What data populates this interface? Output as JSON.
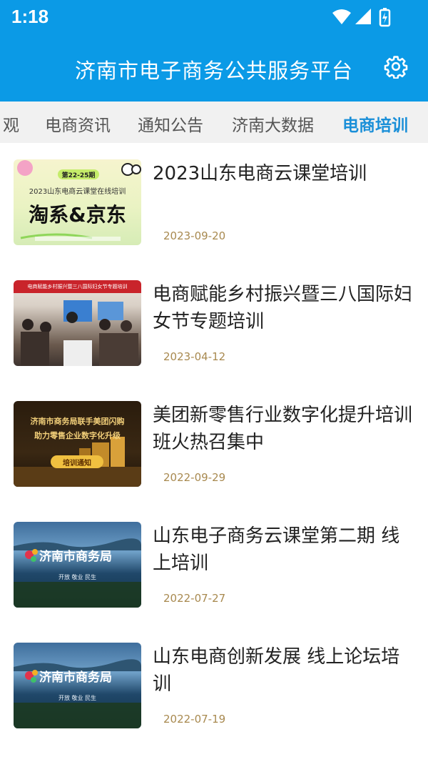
{
  "status": {
    "time": "1:18"
  },
  "app": {
    "title": "济南市电子商务公共服务平台"
  },
  "tabs": [
    {
      "label": "观"
    },
    {
      "label": "电商资讯"
    },
    {
      "label": "通知公告"
    },
    {
      "label": "济南大数据"
    },
    {
      "label": "电商培训"
    }
  ],
  "thumbs": {
    "t1": {
      "badge": "第22-25期",
      "line": "2023山东电商云课堂在线培训",
      "big": "淘系&京东"
    },
    "t2": {
      "banner": "电商赋能乡村振兴暨三八国际妇女节专题培训"
    },
    "t3": {
      "line1": "济南市商务局联手美团闪购",
      "line2": "助力零售企业数字化升级",
      "btn": "培训通知"
    },
    "t4": {
      "org": "济南市商务局",
      "sub": "开放 敬业 民生"
    },
    "t5": {
      "org": "济南市商务局",
      "sub": "开放 敬业 民生"
    }
  },
  "articles": [
    {
      "title": "2023山东电商云课堂培训",
      "date": "2023-09-20"
    },
    {
      "title": "电商赋能乡村振兴暨三八国际妇女节专题培训",
      "date": "2023-04-12"
    },
    {
      "title": "美团新零售行业数字化提升培训班火热召集中",
      "date": "2022-09-29"
    },
    {
      "title": "山东电子商务云课堂第二期 线上培训",
      "date": "2022-07-27"
    },
    {
      "title": "山东电商创新发展 线上论坛培训",
      "date": "2022-07-19"
    }
  ],
  "colors": {
    "primary": "#0b9ae6",
    "active_tab": "#1a8fd8",
    "date": "#a8894f"
  }
}
